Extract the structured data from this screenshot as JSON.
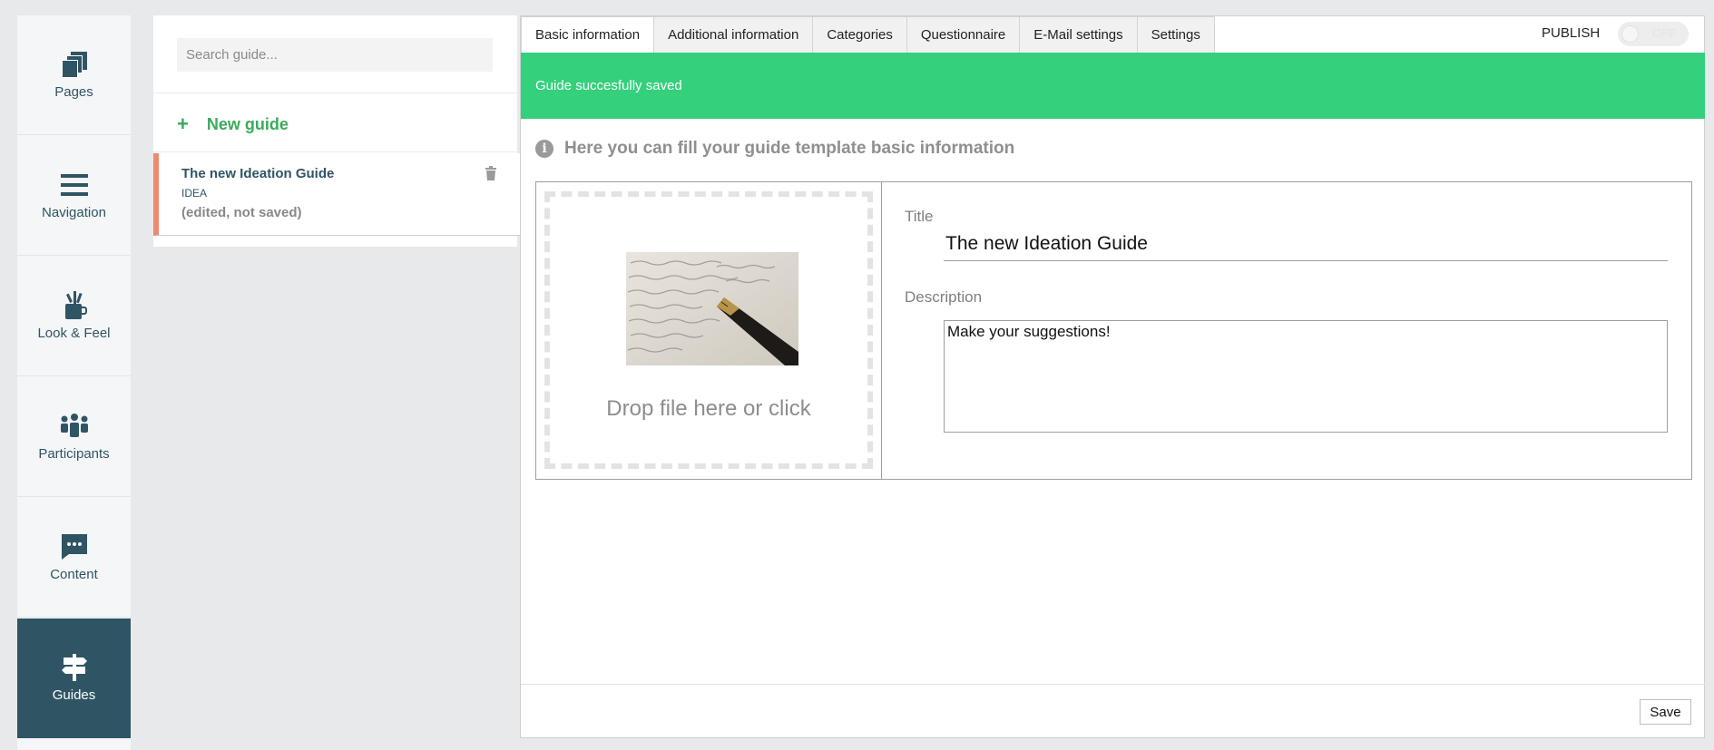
{
  "nav": {
    "items": [
      {
        "label": "Pages",
        "icon": "pages-icon"
      },
      {
        "label": "Navigation",
        "icon": "menu-icon"
      },
      {
        "label": "Look & Feel",
        "icon": "mug-brush-icon"
      },
      {
        "label": "Participants",
        "icon": "people-icon"
      },
      {
        "label": "Content",
        "icon": "chat-bubble-icon"
      },
      {
        "label": "Guides",
        "icon": "signpost-icon"
      }
    ],
    "active": "Guides"
  },
  "guide_list": {
    "search_placeholder": "Search guide...",
    "new_guide_label": "New guide",
    "items": [
      {
        "title": "The new Ideation Guide",
        "type": "IDEA",
        "status": "(edited, not saved)"
      }
    ]
  },
  "tabs": [
    {
      "label": "Basic information",
      "active": true
    },
    {
      "label": "Additional information"
    },
    {
      "label": "Categories"
    },
    {
      "label": "Questionnaire"
    },
    {
      "label": "E-Mail settings"
    },
    {
      "label": "Settings"
    }
  ],
  "publish": {
    "label": "PUBLISH",
    "toggle_label": "OFF",
    "on": false
  },
  "banner": {
    "message": "Guide succesfully saved",
    "color": "#34d07c"
  },
  "form": {
    "intro": "Here you can fill your guide template basic information",
    "drop_text": "Drop file here or click",
    "title_label": "Title",
    "title_value": "The new Ideation Guide",
    "description_label": "Description",
    "description_value": "Make your suggestions!"
  },
  "footer": {
    "save_label": "Save"
  },
  "colors": {
    "primary": "#2f5565",
    "accent_green": "#3aaa5b",
    "item_marker": "#ef8a6f"
  }
}
